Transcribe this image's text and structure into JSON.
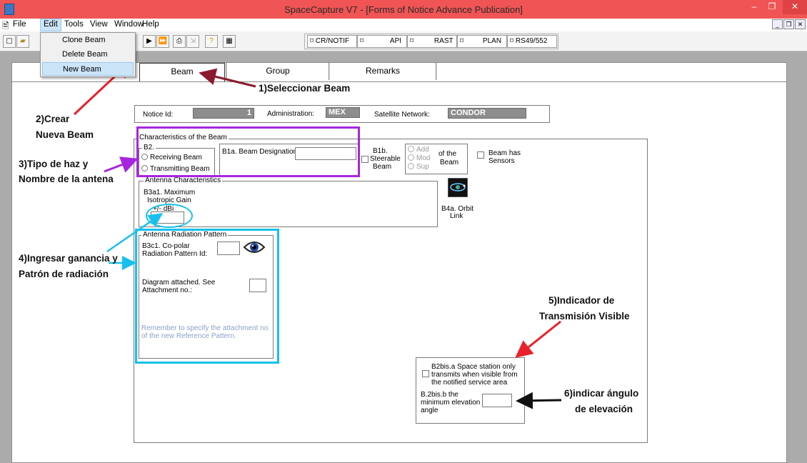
{
  "window": {
    "title": "SpaceCapture V7 - [Forms of Notice Advance Publication]"
  },
  "menu": {
    "file": "File",
    "edit": "Edit",
    "tools": "Tools",
    "view": "View",
    "window": "Window",
    "help": "Help"
  },
  "edit_menu": {
    "clone": "Clone Beam",
    "delete": "Delete Beam",
    "new": "New Beam"
  },
  "toolbar": {
    "cr_notif": "CR/NOTIF",
    "api": "API",
    "rast": "RAST",
    "plan": "PLAN",
    "rs49": "RS49/552"
  },
  "tabs": {
    "beam": "Beam",
    "group": "Group",
    "remarks": "Remarks"
  },
  "notice": {
    "notice_id_label": "Notice Id:",
    "notice_id_value": "1",
    "admin_label": "Administration:",
    "admin_value": "MEX",
    "network_label": "Satellite Network:",
    "network_value": "CONDOR"
  },
  "beam": {
    "section_title": "Characteristics of the Beam",
    "b2_label": "B2.",
    "receiving": "Receiving Beam",
    "transmitting": "Transmitting Beam",
    "designation_label": "B1a. Beam Designation:",
    "steerable_1": "B1b.",
    "steerable_2": "Steerable",
    "steerable_3": "Beam",
    "add": "Add",
    "mod": "Mod",
    "sup": "Sup",
    "of_the_1": "of the",
    "of_the_2": "Beam",
    "sensors_1": "Beam has",
    "sensors_2": "Sensors"
  },
  "antenna": {
    "title": "Antenna Characteristics",
    "gain_1": "B3a1. Maximum",
    "gain_2": "Isotropic Gain",
    "unit": "+/-  dBi",
    "orbit_1": "B4a. Orbit",
    "orbit_2": "Link"
  },
  "pattern": {
    "title": "Antenna Radiation Pattern",
    "copolar_1": "B3c1. Co-polar",
    "copolar_2": "Radiation Pattern Id:",
    "diagram_1": "Diagram attached.  See",
    "diagram_2": "Attachment no.:",
    "note_1": "Remember to specify the attachment no",
    "note_2": "of the new Reference Pattern."
  },
  "visibility": {
    "b2bis_a_1": "B2bis.a  Space station only",
    "b2bis_a_2": "transmits when visible from",
    "b2bis_a_3": "the notified service area",
    "b2bis_b_1": "B.2bis.b  the",
    "b2bis_b_2": "minimum elevation",
    "b2bis_b_3": "angle"
  },
  "annotations": {
    "a1": "1)Seleccionar Beam",
    "a2_1": "2)Crear",
    "a2_2": "Nueva Beam",
    "a3_1": "3)Tipo de haz y",
    "a3_2": "Nombre de la antena",
    "a4_1": "4)Ingresar ganancia y",
    "a4_2": "Patrón de radiación",
    "a5_1": "5)Indicador de",
    "a5_2": "Transmisión Visible",
    "a6_1": "6)indicar ángulo",
    "a6_2": "de elevación"
  },
  "colors": {
    "titlebar": "#f05454",
    "purple_highlight": "#a626e0",
    "cyan_highlight": "#16c0ee",
    "red_arrow": "#e8212b",
    "maroon_arrow": "#8b1a2e",
    "note_text": "#8aa2c8"
  },
  "icons": [
    "app-icon",
    "new-icon",
    "open-icon",
    "play-icon",
    "fast-forward-icon",
    "print-icon",
    "help-icon",
    "calculator-icon",
    "eye-icon",
    "orbit-icon"
  ]
}
